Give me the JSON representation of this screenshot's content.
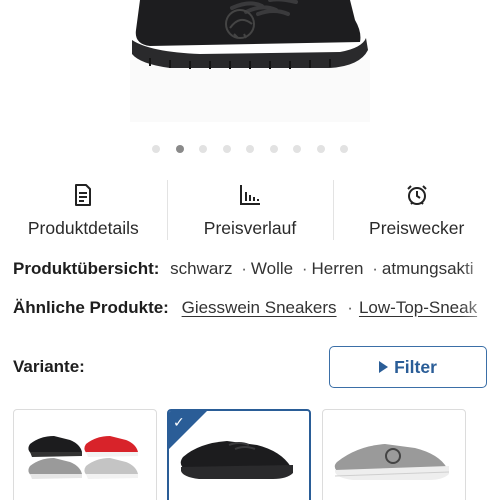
{
  "carousel": {
    "slide_count": 9,
    "active_index": 1
  },
  "actions": [
    {
      "label": "Produktdetails",
      "icon": "document-icon"
    },
    {
      "label": "Preisverlauf",
      "icon": "bar-chart-icon"
    },
    {
      "label": "Preiswecker",
      "icon": "alarm-clock-icon"
    }
  ],
  "overview": {
    "label": "Produktübersicht:",
    "tags": [
      "schwarz",
      "Wolle",
      "Herren",
      "atmungsakti"
    ]
  },
  "similar": {
    "label": "Ähnliche Produkte:",
    "links": [
      "Giesswein Sneakers",
      "Low-Top-Sneak"
    ]
  },
  "variants": {
    "label": "Variante:",
    "filter_label": "Filter",
    "selected_index": 1,
    "items": [
      {
        "name": "multi-color-set"
      },
      {
        "name": "black"
      },
      {
        "name": "grey"
      }
    ]
  },
  "colors": {
    "accent": "#2a5d97",
    "shoe_black": "#1c1c1e",
    "shoe_red": "#d8232a",
    "shoe_grey": "#9a9a9a"
  }
}
